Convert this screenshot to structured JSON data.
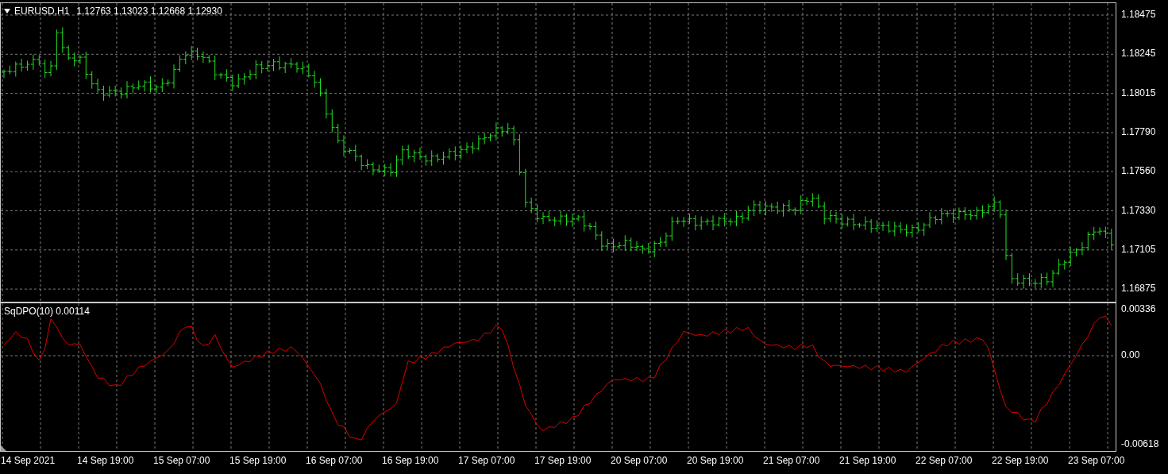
{
  "symbol_bar": {
    "symbol": "EURUSD,H1",
    "ohlc": "1.12763 1.13023 1.12668 1.12930"
  },
  "price_axis": {
    "ticks": [
      "1.18475",
      "1.18245",
      "1.18015",
      "1.17790",
      "1.17560",
      "1.17330",
      "1.17105",
      "1.16875"
    ]
  },
  "indicator": {
    "label": "SqDPO(10) 0.00114",
    "axis_ticks": [
      "0.00336",
      "0.00",
      "-0.00618"
    ]
  },
  "time_axis": {
    "labels": [
      "14 Sep 2021",
      "14 Sep 19:00",
      "15 Sep 07:00",
      "15 Sep 19:00",
      "16 Sep 07:00",
      "16 Sep 19:00",
      "17 Sep 07:00",
      "17 Sep 19:00",
      "20 Sep 07:00",
      "20 Sep 19:00",
      "21 Sep 07:00",
      "21 Sep 19:00",
      "22 Sep 07:00",
      "22 Sep 19:00",
      "23 Sep 07:00"
    ]
  }
}
